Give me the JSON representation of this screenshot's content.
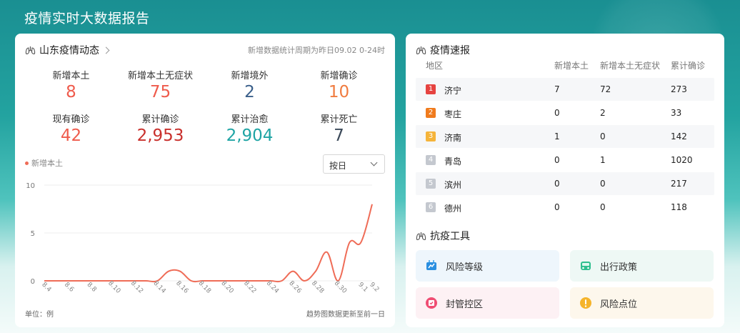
{
  "page_title": "疫情实时大数据报告",
  "overview": {
    "title": "山东疫情动态",
    "period_note": "新增数据统计周期为昨日09.02 0-24时",
    "stats": [
      {
        "label": "新增本土",
        "value": "8",
        "color": "#ef5b4c"
      },
      {
        "label": "新增本土无症状",
        "value": "75",
        "color": "#ef5b4c"
      },
      {
        "label": "新增境外",
        "value": "2",
        "color": "#3a5f8a"
      },
      {
        "label": "新增确诊",
        "value": "10",
        "color": "#f07b3f"
      },
      {
        "label": "现有确诊",
        "value": "42",
        "color": "#ef5b4c"
      },
      {
        "label": "累计确诊",
        "value": "2,953",
        "color": "#c9302c"
      },
      {
        "label": "累计治愈",
        "value": "2,904",
        "color": "#1fa4a4"
      },
      {
        "label": "累计死亡",
        "value": "7",
        "color": "#3c4a5a"
      }
    ],
    "select_value": "按日",
    "unit_note": "单位：例",
    "trend_note": "趋势图数据更新至前一日"
  },
  "chart_data": {
    "type": "line",
    "legend": [
      "新增本土"
    ],
    "x_tick_labels": [
      "8.4",
      "8.6",
      "8.8",
      "8.10",
      "8.12",
      "8.14",
      "8.16",
      "8.18",
      "8.20",
      "8.22",
      "8.24",
      "8.26",
      "8.28",
      "8.30",
      "9.1",
      "9.2"
    ],
    "y_tick_labels": [
      "0",
      "5",
      "10"
    ],
    "ylim": [
      0,
      10
    ],
    "grid": true,
    "line_color": "#ef6c57",
    "series": [
      {
        "name": "新增本土",
        "x": [
          "8.4",
          "8.5",
          "8.6",
          "8.7",
          "8.8",
          "8.9",
          "8.10",
          "8.11",
          "8.12",
          "8.13",
          "8.14",
          "8.15",
          "8.16",
          "8.17",
          "8.18",
          "8.19",
          "8.20",
          "8.21",
          "8.22",
          "8.23",
          "8.24",
          "8.25",
          "8.26",
          "8.27",
          "8.28",
          "8.29",
          "8.30",
          "8.31",
          "9.1",
          "9.2"
        ],
        "values": [
          0,
          0,
          0,
          0,
          0,
          0,
          0,
          0,
          0,
          0,
          0,
          1,
          1,
          0,
          0,
          0,
          0,
          0,
          0,
          0,
          0,
          0,
          1,
          0,
          1,
          3,
          0,
          4,
          4,
          8
        ]
      }
    ]
  },
  "bulletin": {
    "title": "疫情速报",
    "headers": [
      "地区",
      "新增本土",
      "新增本土无症状",
      "累计确诊"
    ],
    "rows": [
      {
        "rank": "1",
        "rank_color": "#e64340",
        "region": "济宁",
        "local": "7",
        "asymptomatic": "72",
        "total": "273"
      },
      {
        "rank": "2",
        "rank_color": "#f07b1d",
        "region": "枣庄",
        "local": "0",
        "asymptomatic": "2",
        "total": "33"
      },
      {
        "rank": "3",
        "rank_color": "#f5b43a",
        "region": "济南",
        "local": "1",
        "asymptomatic": "0",
        "total": "142"
      },
      {
        "rank": "4",
        "rank_color": "#c4c8cf",
        "region": "青岛",
        "local": "0",
        "asymptomatic": "1",
        "total": "1020"
      },
      {
        "rank": "5",
        "rank_color": "#c4c8cf",
        "region": "滨州",
        "local": "0",
        "asymptomatic": "0",
        "total": "217"
      },
      {
        "rank": "6",
        "rank_color": "#c4c8cf",
        "region": "德州",
        "local": "0",
        "asymptomatic": "0",
        "total": "118"
      }
    ]
  },
  "tools": {
    "title": "抗疫工具",
    "items": [
      {
        "label": "风险等级",
        "icon": "risk-level-icon",
        "bg": "#eef6fc",
        "icon_color": "#2b8fe0"
      },
      {
        "label": "出行政策",
        "icon": "travel-car-icon",
        "bg": "#eef8f5",
        "icon_color": "#2fbf8f"
      },
      {
        "label": "封管控区",
        "icon": "lockdown-zone-icon",
        "bg": "#fdf1f4",
        "icon_color": "#ef4d73"
      },
      {
        "label": "风险点位",
        "icon": "risk-point-icon",
        "bg": "#fdf7ec",
        "icon_color": "#f5b42a"
      }
    ]
  }
}
